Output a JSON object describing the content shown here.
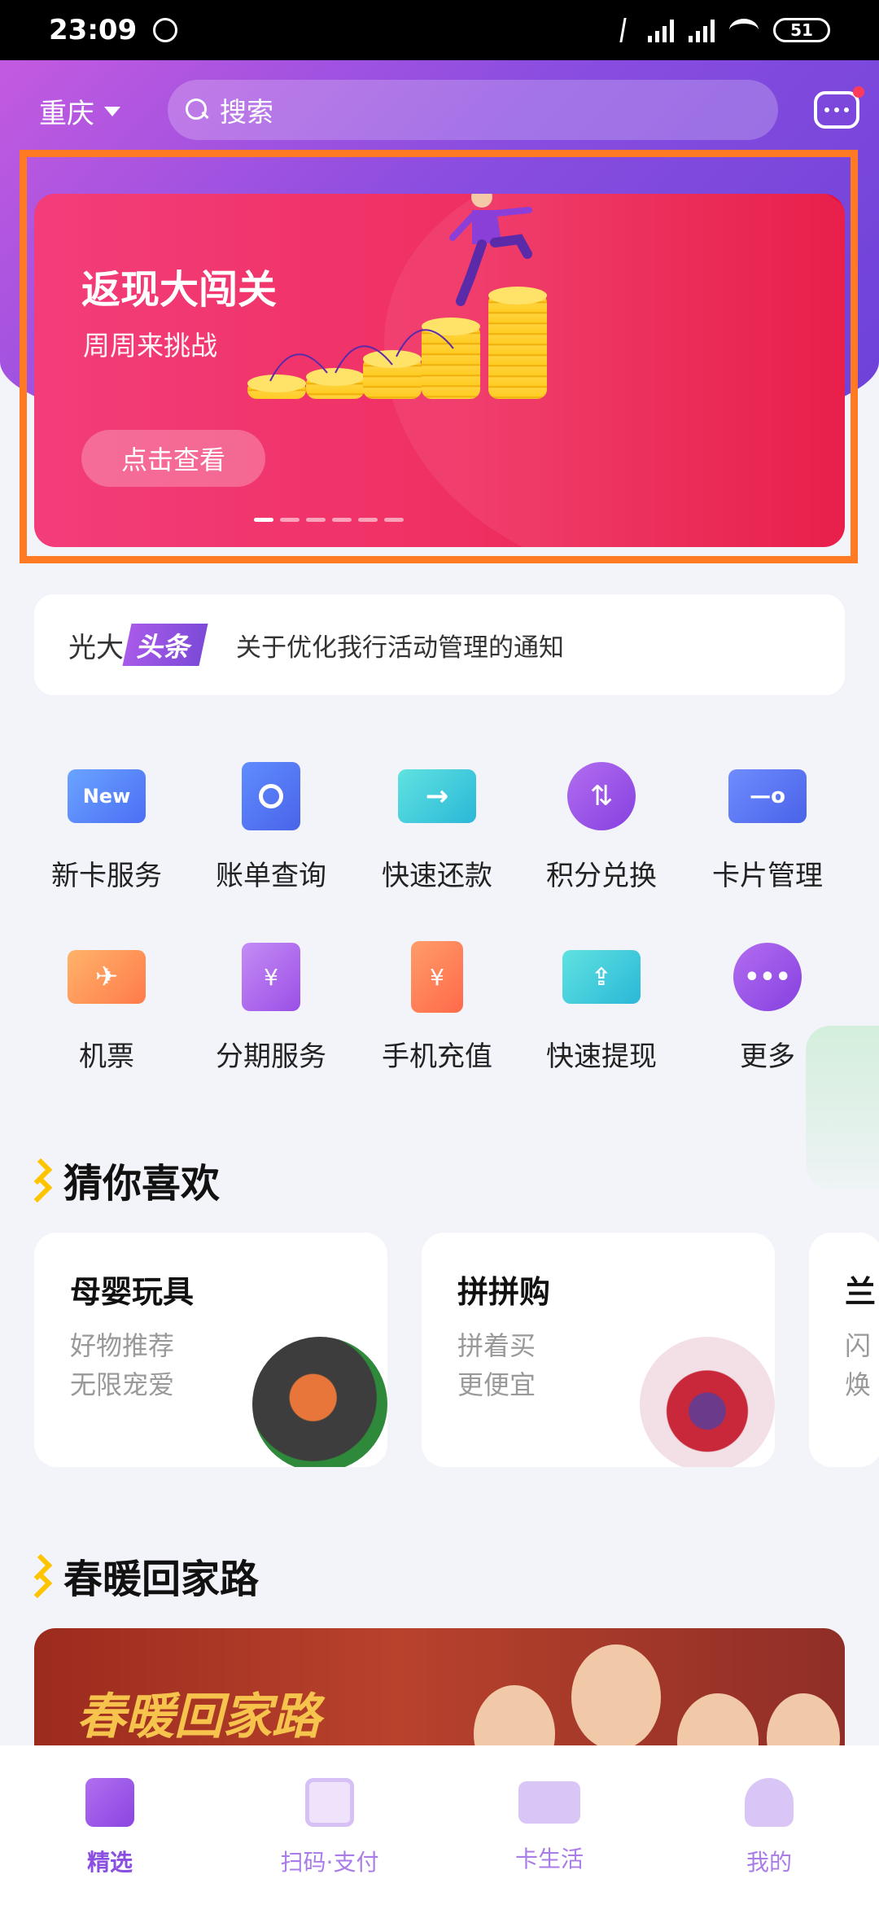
{
  "status_bar": {
    "time": "23:09",
    "battery": "51"
  },
  "header": {
    "city": "重庆",
    "search_placeholder": "搜索"
  },
  "banner": {
    "title": "返现大闯关",
    "subtitle": "周周来挑战",
    "cta": "点击查看",
    "page_count": 6,
    "active_page": 1
  },
  "news": {
    "brand": "光大",
    "tag": "头条",
    "text": "关于优化我行活动管理的通知"
  },
  "services": [
    {
      "label": "新卡服务",
      "icon": "new-card-icon",
      "badge": "New"
    },
    {
      "label": "账单查询",
      "icon": "bill-search-icon"
    },
    {
      "label": "快速还款",
      "icon": "quick-repay-icon"
    },
    {
      "label": "积分兑换",
      "icon": "points-exchange-icon"
    },
    {
      "label": "卡片管理",
      "icon": "card-manage-icon"
    },
    {
      "label": "机票",
      "icon": "flight-ticket-icon"
    },
    {
      "label": "分期服务",
      "icon": "installment-icon"
    },
    {
      "label": "手机充值",
      "icon": "mobile-recharge-icon"
    },
    {
      "label": "快速提现",
      "icon": "quick-withdraw-icon"
    },
    {
      "label": "更多",
      "icon": "more-icon"
    }
  ],
  "section_guess": "猜你喜欢",
  "cards": [
    {
      "title": "母婴玩具",
      "line1": "好物推荐",
      "line2": "无限宠爱"
    },
    {
      "title": "拼拼购",
      "line1": "拼着买",
      "line2": "更便宜"
    },
    {
      "title": "兰",
      "line1": "闪",
      "line2": "焕"
    }
  ],
  "section_spring": "春暖回家路",
  "promo": {
    "title": "春暖回家路"
  },
  "bottom_nav": [
    {
      "label": "精选",
      "icon": "featured-icon",
      "active": true
    },
    {
      "label": "扫码·支付",
      "icon": "scan-pay-icon"
    },
    {
      "label": "卡生活",
      "icon": "card-life-icon"
    },
    {
      "label": "我的",
      "icon": "profile-icon"
    }
  ],
  "colors": {
    "primary": "#8a4de0",
    "banner": "#ef2f61",
    "highlight": "#ff7a22",
    "accent_yellow": "#ffc400"
  }
}
